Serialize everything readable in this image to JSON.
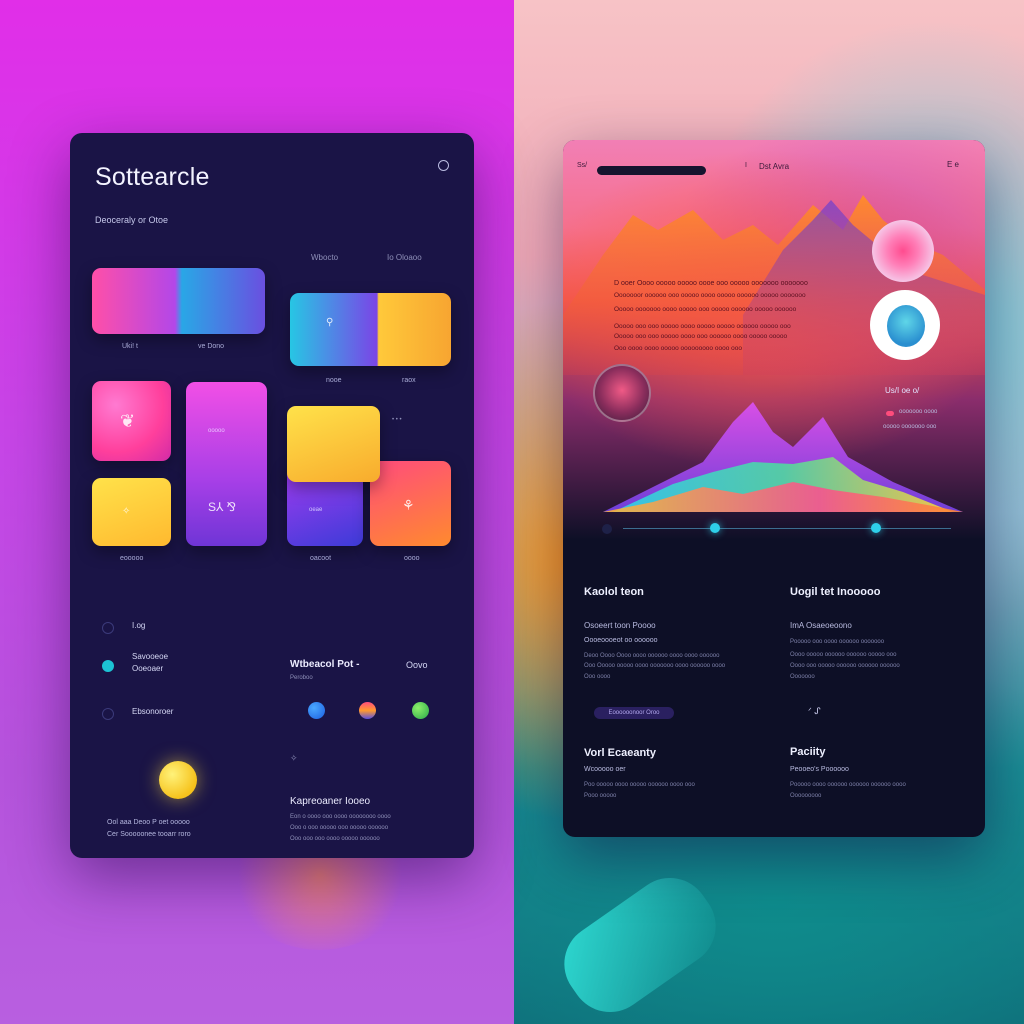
{
  "colors": {
    "left_bg": "#c546e6",
    "left_panel": "#1a1446",
    "right_panel": "#0d0f26",
    "accent_cyan": "#2ed0ea",
    "accent_yellow": "#ffd23a",
    "accent_pink": "#ff4c8f"
  },
  "left": {
    "brand": "Sottearcle",
    "subtitle": "Deoceraly or Otoe",
    "col_a": "Wbocto",
    "col_b": "Io Oloaoo",
    "tiles": [
      {
        "icon": "gradient-banner-tile",
        "caption": "Uki! t",
        "caption_b": "ve Dono"
      },
      {
        "icon": "gradient-split-tile",
        "glyph": "⚲",
        "caption": "nooe",
        "caption_b": "raox"
      },
      {
        "icon": "flamingo-icon",
        "glyph": "❦"
      },
      {
        "icon": "signature-icon",
        "glyph": "S⅄ ⅋",
        "label": "ooooo"
      },
      {
        "icon": "sparkle-icon",
        "glyph": "✧",
        "caption": "eooooo"
      },
      {
        "icon": "yellow-card-tile"
      },
      {
        "icon": "purple-card-tile",
        "label": "oeae",
        "caption": "oacoot"
      },
      {
        "icon": "figure-icon",
        "glyph": "⚘",
        "caption": "oooo"
      }
    ],
    "list": [
      {
        "icon": "circle-icon",
        "label": "I.og"
      },
      {
        "icon": "teal-dot-icon",
        "label": "Savooeoe",
        "label_b": "Ooeoaer"
      },
      {
        "icon": "circle-icon",
        "label": "Ebsonoroer"
      }
    ],
    "web_title": "Wtbeacol Pot -",
    "web_aside": "Oovo",
    "web_sub": "Peroboo",
    "swatch_icon": "✧",
    "bottom_left": [
      "Ool aaa Deoo P oet ooooo",
      "Cer Sooooonee tooarr roro"
    ],
    "kh_title": "Kapreoaner Iooeo",
    "kh_lines": [
      "Eon o oooo ooo oooo oooooooo oooo",
      "Ooo o ooo ooooo ooo ooooo oooooo",
      "Ooo ooo ooo  oooo  ooooo oooooo"
    ]
  },
  "right": {
    "topbar_left": "Ss/",
    "topbar_mid": "I",
    "topbar_nav": "Dst  Avra",
    "topbar_right": "E   e",
    "hero_lines": [
      "D ooer  Oooo ooooo ooooo oooe  ooo ooooo ooooooo ooooooo",
      "Ooooooor oooooo ooo ooooo oooo ooooo oooooo ooooo ooooooo",
      "Ooooo ooooooo oooo ooooo ooo ooooo  oooooo ooooo oooooo",
      "Ooooo ooo ooo ooooo oooo ooooo ooooo oooooo  ooooo ooo",
      "Ooooo ooo ooo ooooo oooo ooo oooooo oooo  ooooo ooooo",
      "Ooo  oooo oooo ooooo ooooooooo oooo  ooo"
    ],
    "side_label": "Us/I oe o/",
    "side_2": "ooooooo oooo",
    "side_3": "ooooo ooooooo ooo",
    "knob_levels": [
      0.28,
      0.77
    ],
    "sec1_title": "Kaolol teon",
    "sec1_sub": "Osoeert toon Poooo",
    "sec1_sub2": "Oooeoooeot oo oooooo",
    "sec1_lines": [
      "Deoo Oooo Oooo oooo oooooo oooo oooo oooooo",
      "Ooo Ooooo ooooo oooo ooooooo oooo oooooo oooo",
      "Ooo oooo"
    ],
    "sec1_chip": "Eoooooonoor  Oroo",
    "sec2_title": "Uogil tet Inooooo",
    "sec2_sub": "ImA  Osaeoeoono",
    "sec2_lines": [
      "Pooooo ooo oooo oooooo ooooooo",
      "Oooo ooooo oooooo  oooooo ooooo ooo",
      "Oooo ooo ooooo oooooo oooooo oooooo",
      "Ooooooo"
    ],
    "sec2_tools": "ᐟ   ᔑ",
    "sec3_title": "Vorl Ecaeanty",
    "sec3_sub": "Wcooooo oer",
    "sec3_lines": [
      "Poo ooooo oooo ooooo oooooo oooo ooo",
      "Pooo ooooo"
    ],
    "sec4_title": "Paciity",
    "sec4_sub": "Peooeo's Poooooo",
    "sec4_lines": [
      "Pooooo oooo oooooo oooooo oooooo oooo",
      "Ooooooooo"
    ]
  }
}
